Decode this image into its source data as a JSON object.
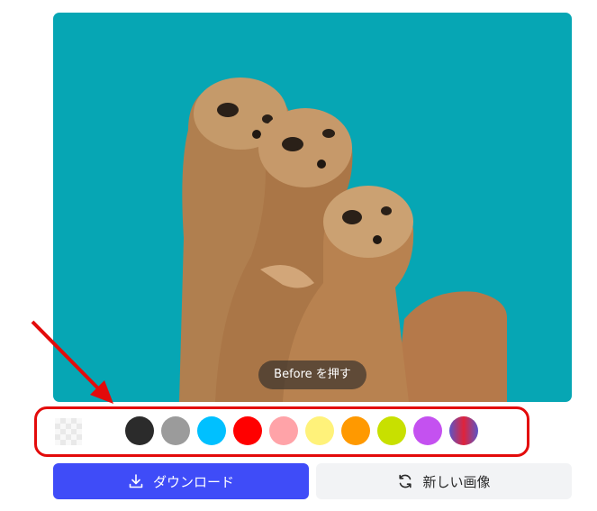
{
  "preview": {
    "background_color": "#06a6b4",
    "before_hint": "Before を押す"
  },
  "swatches": [
    {
      "name": "transparent",
      "color": "transparent"
    },
    {
      "name": "black",
      "color": "#2b2b2b"
    },
    {
      "name": "gray",
      "color": "#9b9b9b"
    },
    {
      "name": "cyan",
      "color": "#00c0ff"
    },
    {
      "name": "red",
      "color": "#ff0000"
    },
    {
      "name": "pink",
      "color": "#ffa3a8"
    },
    {
      "name": "yellow",
      "color": "#fff27a"
    },
    {
      "name": "orange",
      "color": "#ff9900"
    },
    {
      "name": "lime",
      "color": "#c8e000"
    },
    {
      "name": "purple",
      "color": "#c451f0"
    },
    {
      "name": "gradient",
      "color": "linear-gradient(90deg,#5a55c8,#e0233a,#5a55c8)"
    }
  ],
  "annotation_color": "#e30b0b",
  "actions": {
    "download_label": "ダウンロード",
    "download_icon": "download-icon",
    "new_image_label": "新しい画像",
    "new_image_icon": "refresh-icon",
    "download_color": "#3f4cf8"
  }
}
